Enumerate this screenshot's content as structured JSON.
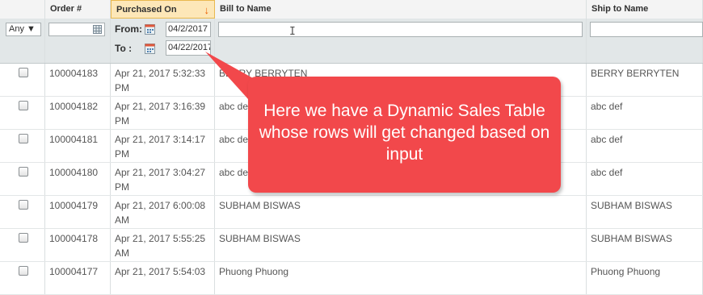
{
  "columns": {
    "order": "Order #",
    "purchased": "Purchased On",
    "bill": "Bill to Name",
    "ship": "Ship to Name"
  },
  "filters": {
    "any": "Any ▼",
    "from_label": "From:",
    "to_label": "To :",
    "from_value": "04/2/2017",
    "to_value": "04/22/2017"
  },
  "rows": [
    {
      "order": "100004183",
      "date": "Apr 21, 2017 5:32:33",
      "ampm": "PM",
      "bill": "BERRY BERRYTEN",
      "ship": "BERRY BERRYTEN"
    },
    {
      "order": "100004182",
      "date": "Apr 21, 2017 3:16:39",
      "ampm": "PM",
      "bill": "abc def",
      "ship": "abc def"
    },
    {
      "order": "100004181",
      "date": "Apr 21, 2017 3:14:17",
      "ampm": "PM",
      "bill": "abc def",
      "ship": "abc def"
    },
    {
      "order": "100004180",
      "date": "Apr 21, 2017 3:04:27",
      "ampm": "PM",
      "bill": "abc def",
      "ship": "abc def"
    },
    {
      "order": "100004179",
      "date": "Apr 21, 2017 6:00:08",
      "ampm": "AM",
      "bill": "SUBHAM BISWAS",
      "ship": "SUBHAM BISWAS"
    },
    {
      "order": "100004178",
      "date": "Apr 21, 2017 5:55:25",
      "ampm": "AM",
      "bill": "SUBHAM BISWAS",
      "ship": "SUBHAM BISWAS"
    },
    {
      "order": "100004177",
      "date": "Apr 21, 2017 5:54:03",
      "ampm": "",
      "bill": "Phuong Phuong",
      "ship": "Phuong Phuong"
    }
  ],
  "callout": {
    "text": "Here we have a Dynamic Sales Table whose rows will get changed based on input",
    "color": "#f2484b"
  },
  "colors": {
    "header_bg": "#f4f4f4",
    "sorted_header_bg": "#fde7b8",
    "filter_bg": "#e2e7e8",
    "sort_arrow": "#eb5e00"
  }
}
